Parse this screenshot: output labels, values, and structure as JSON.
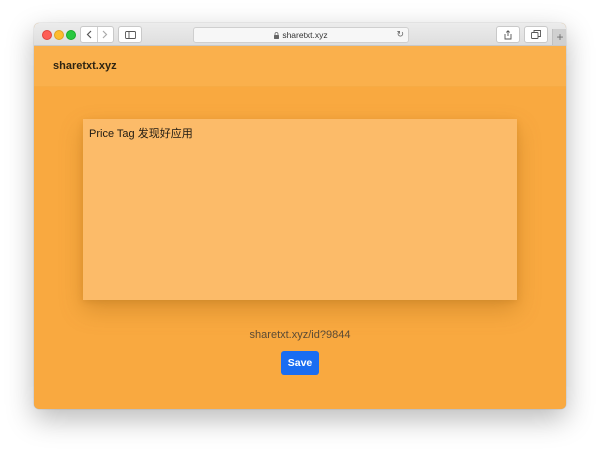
{
  "browser": {
    "address": "sharetxt.xyz",
    "icons": {
      "back": "chevron-left-icon",
      "forward": "chevron-right-icon",
      "sidebar": "sidebar-icon",
      "lock": "lock-icon",
      "reload": "reload-icon",
      "share": "share-icon",
      "tabs": "tabs-icon",
      "new_tab": "plus-icon"
    }
  },
  "site": {
    "brand": "sharetxt.xyz"
  },
  "editor": {
    "text": "Price Tag 发现好应用"
  },
  "share_url": "sharetxt.xyz/id?9844",
  "save_label": "Save",
  "colors": {
    "page_bg": "#f9a940",
    "header_bg": "#fab04c",
    "editor_bg": "#fcbb69",
    "button_bg": "#1a6df2"
  }
}
